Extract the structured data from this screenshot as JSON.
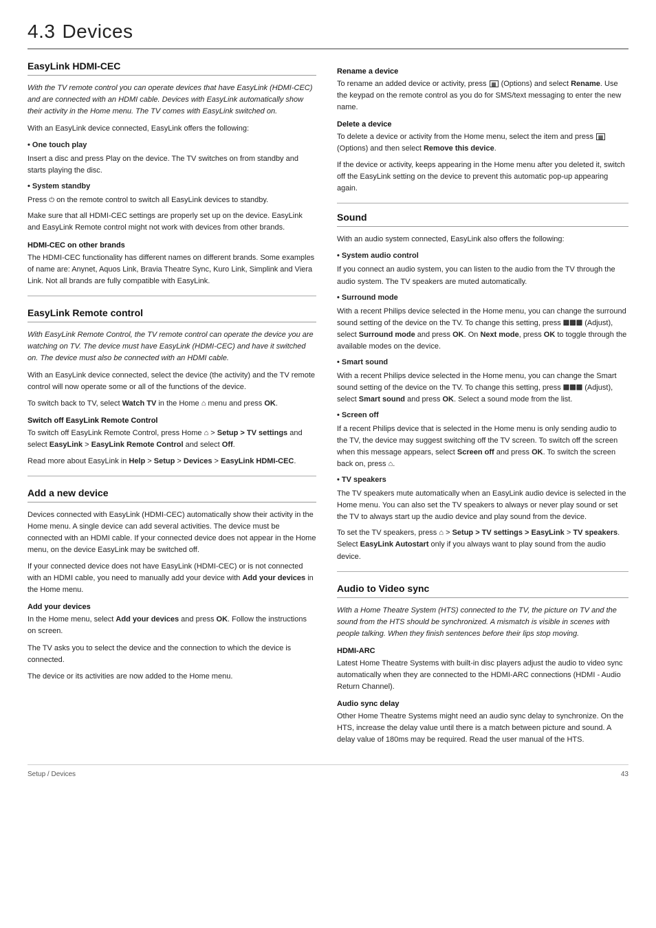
{
  "page": {
    "title": "Devices",
    "section_num": "4.3",
    "footer_left": "Setup / Devices",
    "footer_right": "43"
  },
  "left": {
    "easylink_hdmi": {
      "heading": "EasyLink HDMI-CEC",
      "intro_italic": "With the TV remote control you can operate devices that have EasyLink (HDMI-CEC) and are connected with an HDMI cable. Devices with EasyLink automatically show their activity in the Home menu. The TV comes with EasyLink switched on.",
      "intro_text": "With an EasyLink device connected, EasyLink offers the following:",
      "bullets": [
        {
          "title": "• One touch play",
          "body": "Insert a disc and press Play on the device. The TV switches on from standby and starts playing the disc."
        },
        {
          "title": "• System standby",
          "body": "Press  on the remote control to switch all EasyLink devices to standby."
        }
      ],
      "make_sure_text": "Make sure that all HDMI-CEC settings are properly set up on the device. EasyLink and EasyLink Remote control might not work with devices from other brands.",
      "hdmi_cec_brands": {
        "heading": "HDMI-CEC on other brands",
        "body": "The HDMI-CEC functionality has different names on different brands. Some examples of name are: Anynet, Aquos Link, Bravia Theatre Sync, Kuro Link, Simplink and Viera Link. Not all brands are fully compatible with EasyLink."
      }
    },
    "easylink_remote": {
      "heading": "EasyLink Remote control",
      "intro_italic": "With EasyLink Remote Control, the TV remote control can operate the device you are watching on TV. The device must have EasyLink (HDMI-CEC) and have it switched on. The device must also be connected with an HDMI cable.",
      "para1": "With an EasyLink device connected, select the device (the activity) and the TV remote control will now operate some or all of the functions of the device.",
      "para2_pre": "To switch back to TV, select ",
      "para2_bold": "Watch TV",
      "para2_mid": " in the Home ",
      "para2_post": " menu and press ",
      "para2_ok": "OK",
      "para2_end": ".",
      "switch_off": {
        "heading": "Switch off EasyLink Remote Control",
        "body1_pre": "To switch off EasyLink Remote Control, press Home ",
        "body1_mid": " > Setup > TV settings",
        "body1_post": " and select ",
        "body1_bold2": "EasyLink",
        "body1_post2": " > ",
        "body1_bold3": "EasyLink Remote Control",
        "body1_post3": " and select ",
        "body1_bold4": "Off",
        "body1_end": "."
      },
      "read_more": {
        "pre": "Read more about EasyLink in ",
        "bold1": "Help",
        "mid1": " > ",
        "bold2": "Setup",
        "mid2": " > ",
        "bold3": "Devices",
        "mid3": " > ",
        "bold4": "EasyLink HDMI-CEC",
        "end": "."
      }
    },
    "add_new_device": {
      "heading": "Add a new device",
      "para1": "Devices connected with EasyLink (HDMI-CEC) automatically show their activity in the Home menu. A single device can add several activities. The device must be connected with an HDMI cable. If your connected device does not appear in the Home menu, on the device EasyLink may be switched off.",
      "para2_pre": "If your connected device does not have EasyLink (HDMI-CEC) or is not connected with an HDMI cable, you need to manually add your device with ",
      "para2_bold": "Add your devices",
      "para2_post": " in the Home menu.",
      "add_devices_sub": {
        "heading": "Add your devices",
        "para1_pre": "In the Home menu, select ",
        "para1_bold": "Add your devices",
        "para1_post": " and press ",
        "para1_ok": "OK",
        "para1_end": ". Follow the instructions on screen.",
        "para2": "The TV asks you to select the device and the connection to which the device is connected.",
        "para3": "The device or its activities are now added to the Home menu."
      }
    }
  },
  "right": {
    "rename_device": {
      "heading": "Rename a device",
      "body_pre": "To rename an added device or activity, press ",
      "body_bold": "Options",
      "body_post": ") and select ",
      "body_rename": "Rename",
      "body_end": ". Use the keypad on the remote control as you do for SMS/text messaging to enter the new name."
    },
    "delete_device": {
      "heading": "Delete a device",
      "body_pre": "To delete a device or activity from the Home menu, select the item and press ",
      "body_options": "Options",
      "body_post": ") and then select ",
      "body_remove": "Remove this device",
      "body_end": ".",
      "para2": "If the device or activity, keeps appearing in the Home menu after you deleted it, switch off the EasyLink setting on the device to prevent this automatic pop-up appearing again."
    },
    "sound": {
      "heading": "Sound",
      "intro": "With an audio system connected, EasyLink also offers the following:",
      "bullets": [
        {
          "title": "• System audio control",
          "body": "If you connect an audio system, you can listen to the audio from the TV through the audio system. The TV speakers are muted automatically."
        },
        {
          "title": "• Surround mode",
          "body_pre": "With a recent Philips device selected in the Home menu, you can change the surround sound setting of the device on the TV. To change this setting, press ",
          "body_adjust": "adjust",
          "body_mid": " (Adjust), select ",
          "body_bold": "Surround mode",
          "body_mid2": " and press ",
          "body_ok": "OK",
          "body_post": ". On ",
          "body_next": "Next mode",
          "body_post2": ", press ",
          "body_ok2": "OK",
          "body_end": " to toggle through the available modes on the device."
        },
        {
          "title": "• Smart sound",
          "body_pre": "With a recent Philips device selected in the Home menu, you can change the Smart sound setting of the device on the TV. To change this setting, press ",
          "body_adjust": "adjust",
          "body_mid": " (Adjust), select ",
          "body_bold": "Smart sound",
          "body_post": " and press ",
          "body_ok": "OK",
          "body_end": ". Select a sound mode from the list."
        },
        {
          "title": "• Screen off",
          "body": "If a recent Philips device that is selected in the Home menu is only sending audio to the TV, the device may suggest switching off the TV screen. To switch off the screen when this message appears, select Screen off and press OK. To switch the screen back on, press"
        },
        {
          "title": "• TV speakers",
          "body": "The TV speakers mute automatically when an EasyLink audio device is selected in the Home menu. You can also set the TV speakers to always or never play sound or set the TV to always start up the audio device and play sound from the device."
        }
      ],
      "tv_speakers_note_pre": "To set the TV speakers, press ",
      "tv_speakers_note_bold1": " > Setup > TV settings > EasyLink",
      "tv_speakers_note_post": " > ",
      "tv_speakers_note_bold2": "TV speakers",
      "tv_speakers_note_post2": ". Select ",
      "tv_speakers_note_bold3": "EasyLink Autostart",
      "tv_speakers_note_end": " only if you always want to play sound from the audio device."
    },
    "audio_video_sync": {
      "heading": "Audio to Video sync",
      "intro_italic": "With a Home Theatre System (HTS) connected to the TV, the picture on TV and the sound from the HTS should be synchronized. A mismatch is visible in scenes with people talking. When they finish sentences before their lips stop moving.",
      "hdmi_arc": {
        "heading": "HDMI-ARC",
        "body": "Latest Home Theatre Systems with built-in disc players adjust the audio to video sync automatically when they are connected to the HDMI-ARC connections (HDMI - Audio Return Channel)."
      },
      "audio_sync_delay": {
        "heading": "Audio sync delay",
        "body": "Other Home Theatre Systems might need an audio sync delay to synchronize. On the HTS, increase the delay value until there is a match between picture and sound. A delay value of 180ms may be required. Read the user manual of the HTS."
      }
    }
  }
}
